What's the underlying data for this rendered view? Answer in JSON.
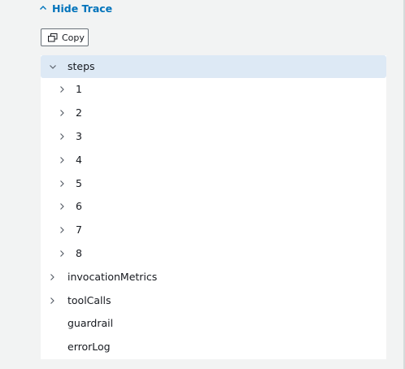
{
  "trace_toggle": {
    "label": "Hide Trace",
    "icon": "chevron-up-icon"
  },
  "copy_button": {
    "label": "Copy",
    "icon": "copy-icon"
  },
  "tree": {
    "root": {
      "label": "steps",
      "expanded": true,
      "selected": true
    },
    "steps": [
      {
        "label": "1"
      },
      {
        "label": "2"
      },
      {
        "label": "3"
      },
      {
        "label": "4"
      },
      {
        "label": "5"
      },
      {
        "label": "6"
      },
      {
        "label": "7"
      },
      {
        "label": "8"
      }
    ],
    "siblings": [
      {
        "label": "invocationMetrics",
        "expandable": true
      },
      {
        "label": "toolCalls",
        "expandable": true
      },
      {
        "label": "guardrail",
        "expandable": false
      },
      {
        "label": "errorLog",
        "expandable": false
      }
    ]
  },
  "colors": {
    "link": "#0073bb",
    "selected_row": "#dde9f5",
    "panel_background": "#f2f3f3"
  }
}
